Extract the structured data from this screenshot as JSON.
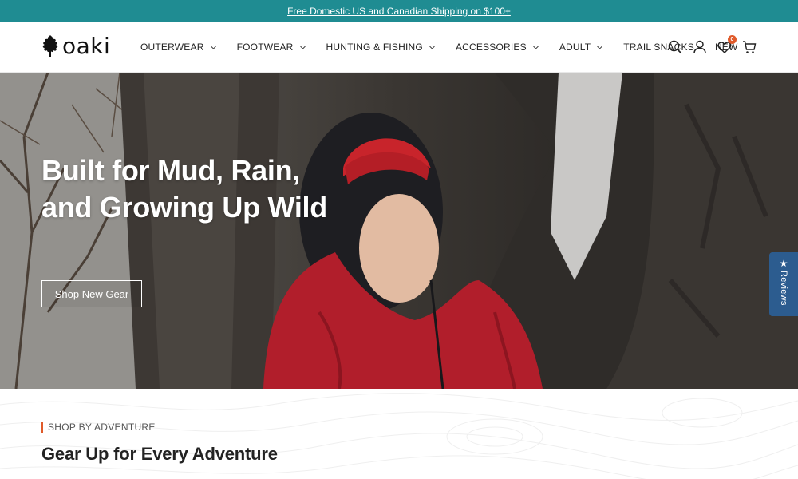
{
  "announcement": {
    "text": "Free Domestic US and Canadian Shipping on $100+"
  },
  "brand": {
    "name": "oaki",
    "logo_icon": "oak-leaf-icon"
  },
  "nav": {
    "items": [
      {
        "label": "OUTERWEAR",
        "has_dropdown": true
      },
      {
        "label": "FOOTWEAR",
        "has_dropdown": true
      },
      {
        "label": "HUNTING & FISHING",
        "has_dropdown": true
      },
      {
        "label": "ACCESSORIES",
        "has_dropdown": true
      },
      {
        "label": "ADULT",
        "has_dropdown": true
      },
      {
        "label": "TRAIL SNACKS",
        "has_dropdown": false
      },
      {
        "label": "NEW",
        "has_dropdown": false
      }
    ]
  },
  "header_icons": {
    "search": "search-icon",
    "account": "account-icon",
    "wishlist": "heart-icon",
    "wishlist_count": "0",
    "cart": "cart-icon"
  },
  "hero": {
    "title": "Built for Mud, Rain, and Growing Up Wild",
    "cta_label": "Shop New Gear"
  },
  "reviews_tab": {
    "label": "Reviews",
    "icon": "star-icon"
  },
  "section": {
    "eyebrow": "SHOP BY ADVENTURE",
    "title": "Gear Up for Every Adventure"
  },
  "colors": {
    "announcement_bg": "#1f8c92",
    "accent": "#e05a2a",
    "reviews_tab_bg": "#2c5c8f"
  }
}
